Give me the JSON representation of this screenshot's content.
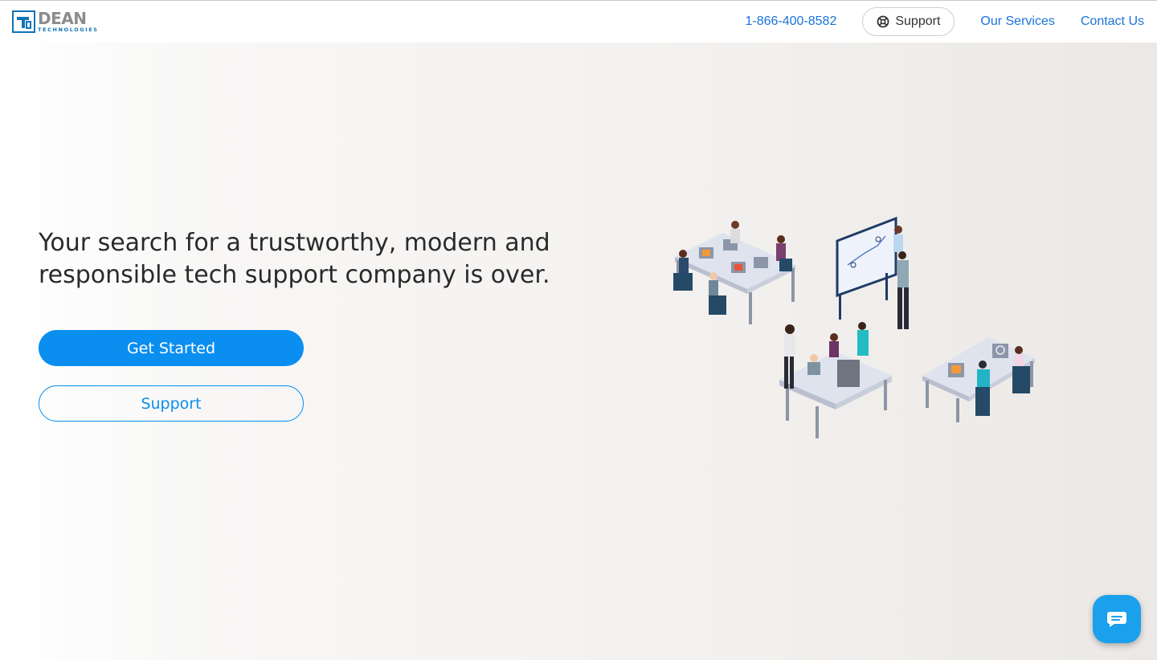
{
  "brand": {
    "name": "DEAN",
    "tagline": "TECHNOLOGIES"
  },
  "nav": {
    "phone": "1-866-400-8582",
    "support_label": "Support",
    "services_label": "Our Services",
    "contact_label": "Contact Us"
  },
  "hero": {
    "headline_line1": "Your search for a trustworthy, modern and",
    "headline_line2": "responsible tech support company is over.",
    "primary_cta": "Get Started",
    "secondary_cta": "Support"
  },
  "icons": {
    "logo": "dean-logo-mark",
    "support": "lifebuoy-icon",
    "chat": "chat-bubble-icon"
  },
  "colors": {
    "accent": "#0a8ef0",
    "link": "#1a73d9",
    "brand_blue": "#0f73b8",
    "chat": "#1aa0ec"
  }
}
